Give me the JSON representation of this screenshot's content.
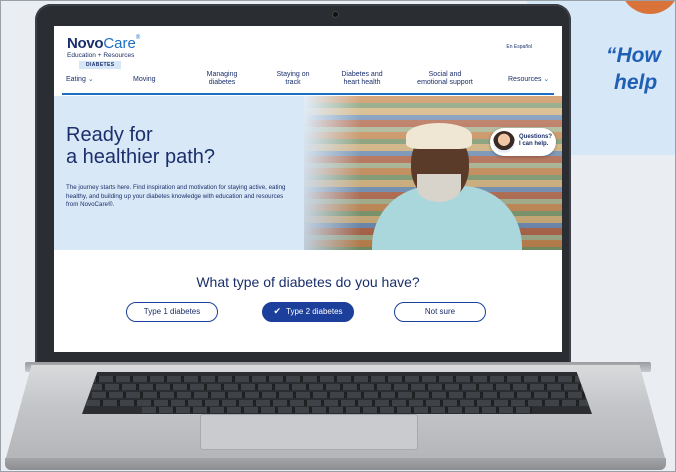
{
  "background": {
    "quote_line1": "“How",
    "quote_line2": "help"
  },
  "site": {
    "logo": {
      "brand_bold": "Novo",
      "brand_light": "Care",
      "tm": "®",
      "subtitle": "Education + Resources",
      "badge": "DIABETES"
    },
    "language_link": "En Español",
    "nav": [
      {
        "line1": "Eating",
        "line2": "",
        "has_chevron": true
      },
      {
        "line1": "Moving",
        "line2": "",
        "has_chevron": false
      },
      {
        "line1": "Managing",
        "line2": "diabetes",
        "has_chevron": false
      },
      {
        "line1": "Staying on",
        "line2": "track",
        "has_chevron": false
      },
      {
        "line1": "Diabetes and",
        "line2": "heart health",
        "has_chevron": false
      },
      {
        "line1": "Social and",
        "line2": "emotional support",
        "has_chevron": false
      },
      {
        "line1": "Resources",
        "line2": "",
        "has_chevron": true
      }
    ],
    "hero": {
      "title_line1": "Ready for",
      "title_line2": "a healthier path?",
      "body": "The journey starts here. Find inspiration and motivation for staying active, eating healthy, and building up your diabetes knowledge with education and resources from NovoCare®."
    },
    "help_chip": {
      "line1": "Questions?",
      "line2": "I can help."
    },
    "question": "What type of diabetes do you have?",
    "choices": [
      {
        "label": "Type 1 diabetes",
        "selected": false
      },
      {
        "label": "Type 2 diabetes",
        "selected": true
      },
      {
        "label": "Not sure",
        "selected": false
      }
    ]
  },
  "colors": {
    "brand_navy": "#1a2f6b",
    "brand_blue": "#1b6ec2",
    "hero_bg": "#d9e8f7",
    "quote_blue": "#1f5fb4"
  }
}
